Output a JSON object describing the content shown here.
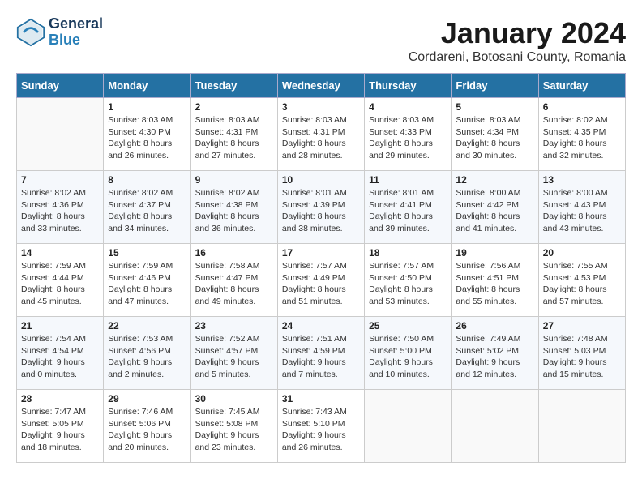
{
  "logo": {
    "line1": "General",
    "line2": "Blue"
  },
  "title": "January 2024",
  "subtitle": "Cordareni, Botosani County, Romania",
  "days_of_week": [
    "Sunday",
    "Monday",
    "Tuesday",
    "Wednesday",
    "Thursday",
    "Friday",
    "Saturday"
  ],
  "weeks": [
    [
      {
        "day": "",
        "info": ""
      },
      {
        "day": "1",
        "info": "Sunrise: 8:03 AM\nSunset: 4:30 PM\nDaylight: 8 hours\nand 26 minutes."
      },
      {
        "day": "2",
        "info": "Sunrise: 8:03 AM\nSunset: 4:31 PM\nDaylight: 8 hours\nand 27 minutes."
      },
      {
        "day": "3",
        "info": "Sunrise: 8:03 AM\nSunset: 4:31 PM\nDaylight: 8 hours\nand 28 minutes."
      },
      {
        "day": "4",
        "info": "Sunrise: 8:03 AM\nSunset: 4:33 PM\nDaylight: 8 hours\nand 29 minutes."
      },
      {
        "day": "5",
        "info": "Sunrise: 8:03 AM\nSunset: 4:34 PM\nDaylight: 8 hours\nand 30 minutes."
      },
      {
        "day": "6",
        "info": "Sunrise: 8:02 AM\nSunset: 4:35 PM\nDaylight: 8 hours\nand 32 minutes."
      }
    ],
    [
      {
        "day": "7",
        "info": "Sunrise: 8:02 AM\nSunset: 4:36 PM\nDaylight: 8 hours\nand 33 minutes."
      },
      {
        "day": "8",
        "info": "Sunrise: 8:02 AM\nSunset: 4:37 PM\nDaylight: 8 hours\nand 34 minutes."
      },
      {
        "day": "9",
        "info": "Sunrise: 8:02 AM\nSunset: 4:38 PM\nDaylight: 8 hours\nand 36 minutes."
      },
      {
        "day": "10",
        "info": "Sunrise: 8:01 AM\nSunset: 4:39 PM\nDaylight: 8 hours\nand 38 minutes."
      },
      {
        "day": "11",
        "info": "Sunrise: 8:01 AM\nSunset: 4:41 PM\nDaylight: 8 hours\nand 39 minutes."
      },
      {
        "day": "12",
        "info": "Sunrise: 8:00 AM\nSunset: 4:42 PM\nDaylight: 8 hours\nand 41 minutes."
      },
      {
        "day": "13",
        "info": "Sunrise: 8:00 AM\nSunset: 4:43 PM\nDaylight: 8 hours\nand 43 minutes."
      }
    ],
    [
      {
        "day": "14",
        "info": "Sunrise: 7:59 AM\nSunset: 4:44 PM\nDaylight: 8 hours\nand 45 minutes."
      },
      {
        "day": "15",
        "info": "Sunrise: 7:59 AM\nSunset: 4:46 PM\nDaylight: 8 hours\nand 47 minutes."
      },
      {
        "day": "16",
        "info": "Sunrise: 7:58 AM\nSunset: 4:47 PM\nDaylight: 8 hours\nand 49 minutes."
      },
      {
        "day": "17",
        "info": "Sunrise: 7:57 AM\nSunset: 4:49 PM\nDaylight: 8 hours\nand 51 minutes."
      },
      {
        "day": "18",
        "info": "Sunrise: 7:57 AM\nSunset: 4:50 PM\nDaylight: 8 hours\nand 53 minutes."
      },
      {
        "day": "19",
        "info": "Sunrise: 7:56 AM\nSunset: 4:51 PM\nDaylight: 8 hours\nand 55 minutes."
      },
      {
        "day": "20",
        "info": "Sunrise: 7:55 AM\nSunset: 4:53 PM\nDaylight: 8 hours\nand 57 minutes."
      }
    ],
    [
      {
        "day": "21",
        "info": "Sunrise: 7:54 AM\nSunset: 4:54 PM\nDaylight: 9 hours\nand 0 minutes."
      },
      {
        "day": "22",
        "info": "Sunrise: 7:53 AM\nSunset: 4:56 PM\nDaylight: 9 hours\nand 2 minutes."
      },
      {
        "day": "23",
        "info": "Sunrise: 7:52 AM\nSunset: 4:57 PM\nDaylight: 9 hours\nand 5 minutes."
      },
      {
        "day": "24",
        "info": "Sunrise: 7:51 AM\nSunset: 4:59 PM\nDaylight: 9 hours\nand 7 minutes."
      },
      {
        "day": "25",
        "info": "Sunrise: 7:50 AM\nSunset: 5:00 PM\nDaylight: 9 hours\nand 10 minutes."
      },
      {
        "day": "26",
        "info": "Sunrise: 7:49 AM\nSunset: 5:02 PM\nDaylight: 9 hours\nand 12 minutes."
      },
      {
        "day": "27",
        "info": "Sunrise: 7:48 AM\nSunset: 5:03 PM\nDaylight: 9 hours\nand 15 minutes."
      }
    ],
    [
      {
        "day": "28",
        "info": "Sunrise: 7:47 AM\nSunset: 5:05 PM\nDaylight: 9 hours\nand 18 minutes."
      },
      {
        "day": "29",
        "info": "Sunrise: 7:46 AM\nSunset: 5:06 PM\nDaylight: 9 hours\nand 20 minutes."
      },
      {
        "day": "30",
        "info": "Sunrise: 7:45 AM\nSunset: 5:08 PM\nDaylight: 9 hours\nand 23 minutes."
      },
      {
        "day": "31",
        "info": "Sunrise: 7:43 AM\nSunset: 5:10 PM\nDaylight: 9 hours\nand 26 minutes."
      },
      {
        "day": "",
        "info": ""
      },
      {
        "day": "",
        "info": ""
      },
      {
        "day": "",
        "info": ""
      }
    ]
  ]
}
